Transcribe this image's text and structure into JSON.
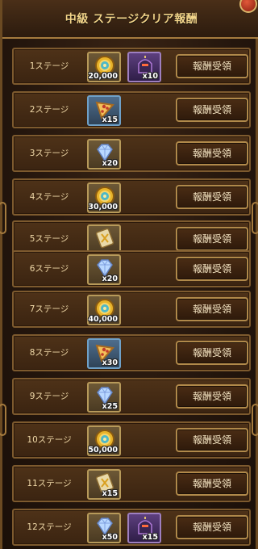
{
  "header": {
    "title": "中級 ステージクリア報酬"
  },
  "claim_label": "報酬受領",
  "rows": [
    {
      "label": "1ステージ",
      "items": [
        {
          "icon": "gold-coin-icon",
          "qty": "20,000"
        },
        {
          "icon": "dark-knight-helmet-icon",
          "qty": "x10"
        }
      ]
    },
    {
      "label": "2ステージ",
      "items": [
        {
          "icon": "pizza-slice-icon",
          "qty": "x15"
        }
      ]
    },
    {
      "label": "3ステージ",
      "items": [
        {
          "icon": "diamond-gem-icon",
          "qty": "x20"
        }
      ]
    },
    {
      "label": "4ステージ",
      "items": [
        {
          "icon": "gold-coin-icon",
          "qty": "30,000"
        }
      ]
    },
    {
      "label": "5ステージ",
      "items": [
        {
          "icon": "scroll-icon",
          "qty": ""
        }
      ]
    },
    {
      "label": "6ステージ",
      "items": [
        {
          "icon": "diamond-gem-icon",
          "qty": "x20"
        }
      ]
    },
    {
      "label": "7ステージ",
      "items": [
        {
          "icon": "gold-coin-icon",
          "qty": "40,000"
        }
      ]
    },
    {
      "label": "8ステージ",
      "items": [
        {
          "icon": "pizza-slice-icon",
          "qty": "x30"
        }
      ]
    },
    {
      "label": "9ステージ",
      "items": [
        {
          "icon": "diamond-gem-icon",
          "qty": "x25"
        }
      ]
    },
    {
      "label": "10ステージ",
      "items": [
        {
          "icon": "gold-coin-icon",
          "qty": "50,000"
        }
      ]
    },
    {
      "label": "11ステージ",
      "items": [
        {
          "icon": "scroll-icon",
          "qty": "x15"
        }
      ]
    },
    {
      "label": "12ステージ",
      "items": [
        {
          "icon": "diamond-gem-icon",
          "qty": "x50"
        },
        {
          "icon": "dark-knight-helmet-icon",
          "qty": "x15"
        }
      ]
    }
  ]
}
